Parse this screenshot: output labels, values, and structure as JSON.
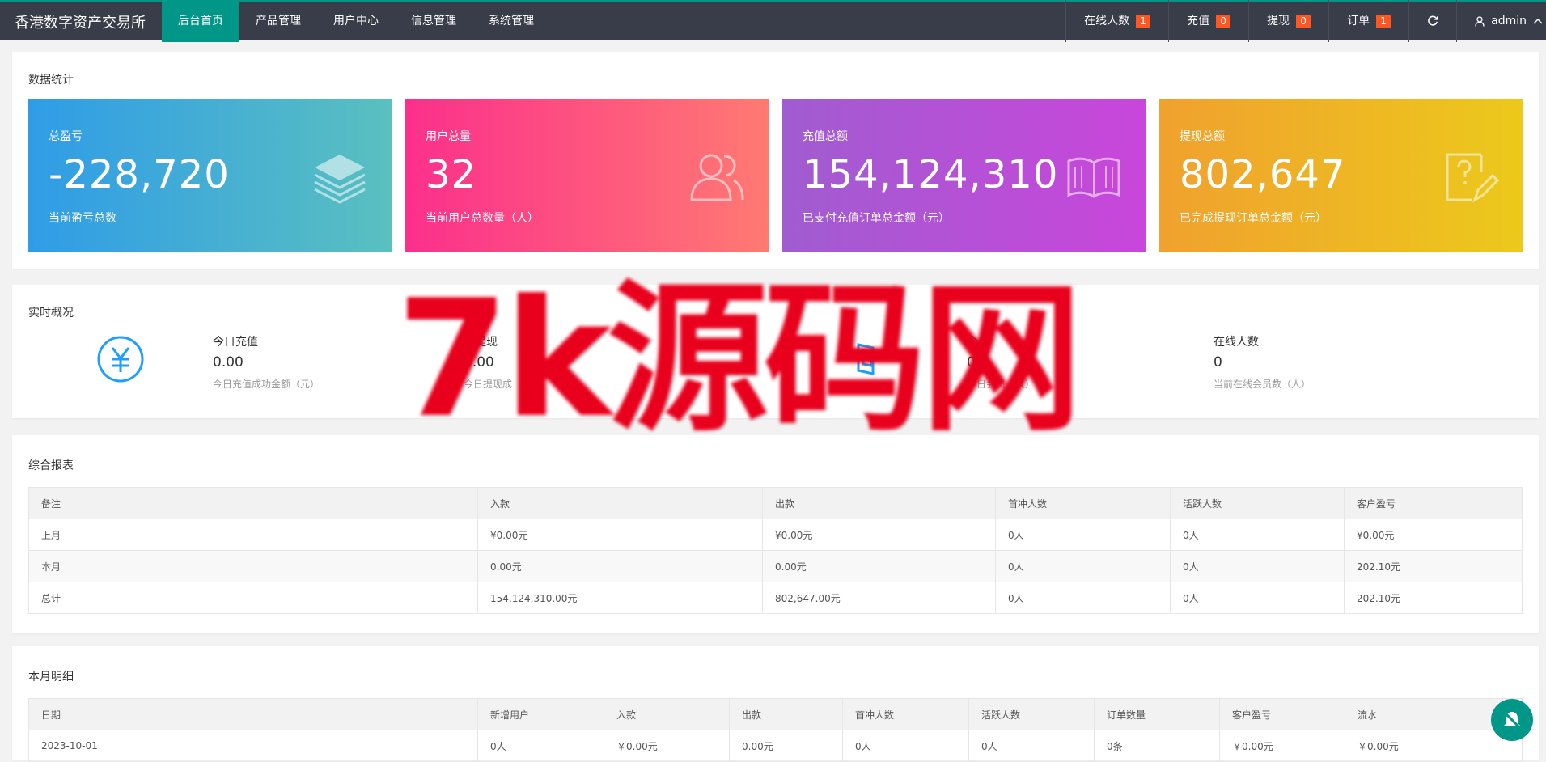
{
  "brand": "香港数字资产交易所",
  "nav": [
    "后台首页",
    "产品管理",
    "用户中心",
    "信息管理",
    "系统管理"
  ],
  "right_nav": {
    "online": {
      "label": "在线人数",
      "badge": "1"
    },
    "recharge": {
      "label": "充值",
      "badge": "0"
    },
    "withdraw": {
      "label": "提现",
      "badge": "0"
    },
    "order": {
      "label": "订单",
      "badge": "1"
    },
    "user": "admin"
  },
  "stats": {
    "title": "数据统计",
    "cards": [
      {
        "title": "总盈亏",
        "value": "-228,720",
        "sub": "当前盈亏总数",
        "icon": "layers-icon"
      },
      {
        "title": "用户总量",
        "value": "32",
        "sub": "当前用户总数量（人）",
        "icon": "users-icon"
      },
      {
        "title": "充值总额",
        "value": "154,124,310",
        "sub": "已支付充值订单总金额（元）",
        "icon": "book-icon"
      },
      {
        "title": "提现总额",
        "value": "802,647",
        "sub": "已完成提现订单总金额（元）",
        "icon": "edit-icon"
      }
    ]
  },
  "realtime": {
    "title": "实时概况",
    "items": [
      {
        "label": "今日充值",
        "value": "0.00",
        "sub": "今日充值成功金额（元）"
      },
      {
        "label": "日提现",
        "value": "0.00",
        "sub": "今日提现成"
      },
      {
        "label": "今日",
        "value": "0",
        "sub": "今日会员（人）"
      },
      {
        "label": "在线人数",
        "value": "0",
        "sub": "当前在线会员数（人）"
      }
    ]
  },
  "report": {
    "title": "综合报表",
    "headers": [
      "备注",
      "入款",
      "出款",
      "首冲人数",
      "活跃人数",
      "客户盈亏"
    ],
    "rows": [
      [
        "上月",
        "¥0.00元",
        "¥0.00元",
        "0人",
        "0人",
        "¥0.00元"
      ],
      [
        "本月",
        "0.00元",
        "0.00元",
        "0人",
        "0人",
        "202.10元"
      ],
      [
        "总计",
        "154,124,310.00元",
        "802,647.00元",
        "0人",
        "0人",
        "202.10元"
      ]
    ]
  },
  "monthly": {
    "title": "本月明细",
    "headers": [
      "日期",
      "新增用户",
      "入款",
      "出款",
      "首冲人数",
      "活跃人数",
      "订单数量",
      "客户盈亏",
      "流水"
    ],
    "rows": [
      [
        "2023-10-01",
        "0人",
        "￥0.00元",
        "0.00元",
        "0人",
        "0人",
        "0条",
        "￥0.00元",
        "￥0.00元"
      ]
    ]
  },
  "watermark": "7k源码网"
}
